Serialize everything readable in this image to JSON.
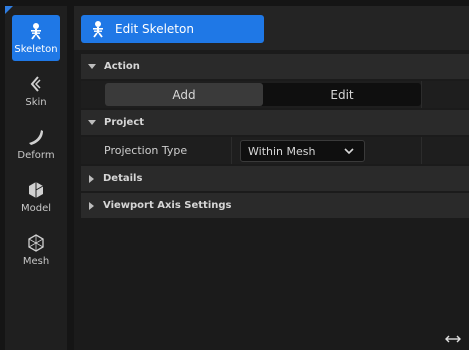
{
  "modes": [
    {
      "label": "Skeleton",
      "icon": "skeleton-icon",
      "active": true
    },
    {
      "label": "Skin",
      "icon": "skin-icon",
      "active": false
    },
    {
      "label": "Deform",
      "icon": "deform-icon",
      "active": false
    },
    {
      "label": "Model",
      "icon": "model-icon",
      "active": false
    },
    {
      "label": "Mesh",
      "icon": "mesh-icon",
      "active": false
    }
  ],
  "toolbar": {
    "edit_skeleton_label": "Edit Skeleton"
  },
  "sections": {
    "action": {
      "label": "Action",
      "expanded": true,
      "buttons": {
        "add": "Add",
        "edit": "Edit"
      },
      "selected": "Add"
    },
    "project": {
      "label": "Project",
      "expanded": true,
      "projection_type_label": "Projection Type",
      "projection_type_value": "Within Mesh"
    },
    "details": {
      "label": "Details",
      "expanded": false
    },
    "viewport_axis": {
      "label": "Viewport Axis Settings",
      "expanded": false
    }
  },
  "colors": {
    "accent": "#1f78e6"
  }
}
